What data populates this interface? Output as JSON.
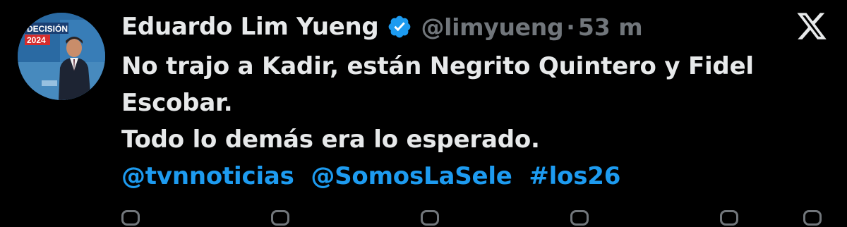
{
  "avatar": {
    "badge_line1": "DECISIÓN",
    "badge_line2": "2024"
  },
  "author": {
    "display_name": "Eduardo Lim Yueng",
    "handle": "@limyueng",
    "separator": "·",
    "time": "53 m",
    "verified_color": "#1d9bf0"
  },
  "tweet": {
    "lines": [
      "No trajo a Kadir, están Negrito Quintero y Fidel",
      "Escobar.",
      "Todo lo demás era lo esperado."
    ],
    "tags": [
      "@tvnnoticias",
      "@SomosLaSele",
      "#los26"
    ]
  },
  "actions": [
    "reply-icon",
    "repost-icon",
    "like-icon",
    "views-icon",
    "bookmark-icon",
    "share-icon"
  ],
  "colors": {
    "background": "#000000",
    "text": "#e7e9ea",
    "muted": "#71767b",
    "link": "#1d9bf0"
  }
}
